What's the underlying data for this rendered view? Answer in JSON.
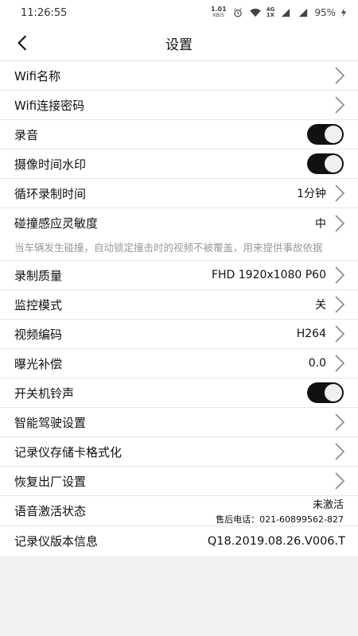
{
  "status_bar": {
    "time": "11:26:55",
    "net_speed_value": "1.01",
    "net_speed_unit": "KB/S",
    "network_type_top": "4G",
    "network_type_bottom": "1X",
    "battery": "95%"
  },
  "header": {
    "title": "设置"
  },
  "settings": {
    "wifi_name": {
      "label": "Wifi名称"
    },
    "wifi_password": {
      "label": "Wifi连接密码"
    },
    "audio_record": {
      "label": "录音",
      "enabled": true
    },
    "time_watermark": {
      "label": "摄像时间水印",
      "enabled": true
    },
    "loop_record": {
      "label": "循环录制时间",
      "value": "1分钟"
    },
    "collision_sensitivity": {
      "label": "碰撞感应灵敏度",
      "value": "中"
    },
    "collision_note": "当车辆发生碰撞，自动锁定撞击时的视频不被覆盖，用来提供事故依据",
    "record_quality": {
      "label": "录制质量",
      "value": "FHD 1920x1080 P60"
    },
    "monitor_mode": {
      "label": "监控模式",
      "value": "关"
    },
    "video_codec": {
      "label": "视频编码",
      "value": "H264"
    },
    "exposure": {
      "label": "曝光补偿",
      "value": "0.0"
    },
    "power_sound": {
      "label": "开关机铃声",
      "enabled": true
    },
    "smart_driving": {
      "label": "智能驾驶设置"
    },
    "format_sd": {
      "label": "记录仪存储卡格式化"
    },
    "factory_reset": {
      "label": "恢复出厂设置"
    },
    "voice_activation": {
      "label": "语音激活状态",
      "status": "未激活",
      "service_phone": "售后电话：021-60899562-827"
    },
    "version": {
      "label": "记录仪版本信息",
      "value": "Q18.2019.08.26.V006.T"
    }
  },
  "colors": {
    "toggle_on": "#111111",
    "background": "#f2f2f2",
    "note_text": "#9a9a9a"
  }
}
